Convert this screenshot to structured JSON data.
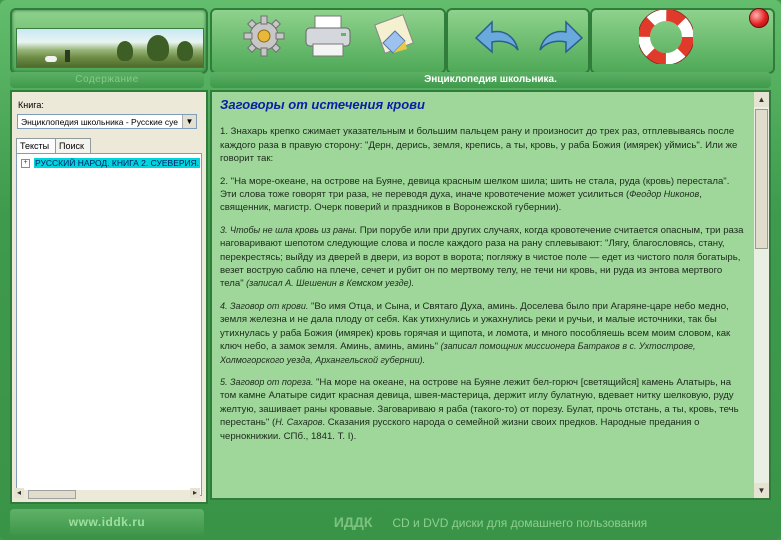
{
  "header": {
    "left_label": "Содержание",
    "right_label": "Энциклопедия школьника."
  },
  "toolbar": {
    "buttons": [
      "gear-icon",
      "printer-icon",
      "notes-icon",
      "back-arrow-icon",
      "forward-arrow-icon",
      "lifebuoy-icon"
    ]
  },
  "sidebar": {
    "book_label": "Книга:",
    "book_value": "Энциклопедия школьника - Русские суе",
    "tabs": [
      "Тексты",
      "Поиск"
    ],
    "tree_item": "РУССКИЙ НАРОД. КНИГА 2. СУЕВЕРИЯ."
  },
  "article": {
    "title": "Заговоры от истечения крови",
    "p1": "1. Знахарь крепко сжимает указательным и большим пальцем рану и произносит до трех раз, отплевываясь после каждого раза в правую сторону: \"Дерн, дерись, земля, крепись, а ты, кровь, у раба Божия (имярек) уймись\". Или же говорит так:",
    "p2_text": "2. \"На море-океане, на острове на Буяне, девица красным шелком шила; шить не стала, руда (кровь) перестала\". Эти слова тоже говорят три раза, не переводя духа, иначе кровотечение может усилиться (",
    "p2_italic": "Феодор Никонов",
    "p2_tail": ", священник, магистр. Очерк поверий и праздников в Воронежской губернии).",
    "p3_italic_head": "3. Чтобы не шла кровь из раны.",
    "p3_text": " При порубе или при других случаях, когда кровотечение считается опасным, три раза наговаривают шепотом следующие слова и после каждого раза на рану сплевывают: \"Лягу, благословясь, стану, перекрестясь; выйду из дверей в двери, из ворот в ворота; погляжу в чистое поле — едет из чистого поля богатырь, везет вострую саблю на плече, сечет и рубит он по мертвому телу, не течи ни кровь, ни руда из энтова мертвого тела\"",
    "p3_tail_italic": " (записал А. Шешенин в Кемском уезде).",
    "p4_italic_head": "4. Заговор от крови.",
    "p4_text": " \"Во имя Отца, и Сына, и Святаго Духа, аминь. Доселева было при Агаряне-царе небо медно, земля железна и не дала плоду от себя. Как утихнулись и ужахнулись реки и ручьи, и малые источники, так бы утихнулась у раба Божия (имярек) кровь горячая и щипота, и ломота, и много пособляешь всем моим словом, как ключ небо, а замок земля. Аминь, аминь, аминь\"",
    "p4_tail_italic": " (записал помощник миссионера Батраков в с. Ухтострове, Холмогорского уезда, Архангельской губернии).",
    "p5_italic_head": "5. Заговор от пореза.",
    "p5_text": " \"На море на океане, на острове на Буяне лежит бел-горюч [светящийся] камень Алатырь, на том камне Алатыре сидит красная девица, швея-мастерица, держит иглу булатную, вдевает нитку шелковую, руду желтую, зашивает раны кровавые. Заговариваю я раба (такого-то) от порезу. Булат, прочь отстань, а ты, кровь, течь перестань\" (",
    "p5_italic2": "Н. Сахаров",
    "p5_tail": ". Сказания русского народа о семейной жизни своих предков. Народные предания о чернокнижии. СПб., 1841. Т. I)."
  },
  "footer": {
    "site": "www.iddk.ru",
    "brand": "ИДДК",
    "slogan": "CD и DVD диски для домашнего пользования"
  }
}
